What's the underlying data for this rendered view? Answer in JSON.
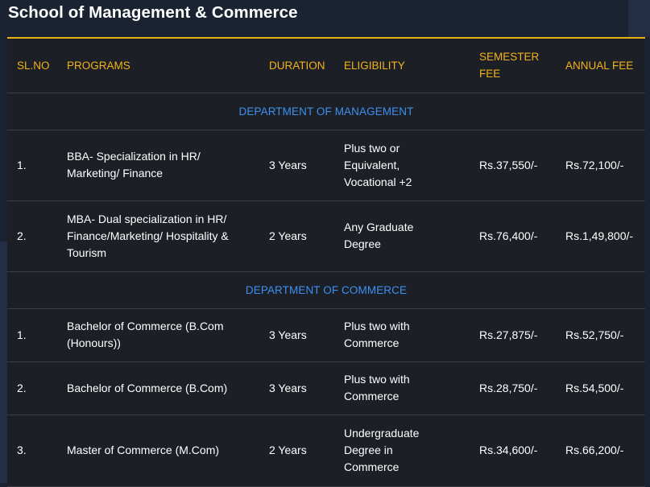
{
  "title": "School of Management & Commerce",
  "table": {
    "headers": {
      "sl_no": "SL.NO",
      "programs": "PROGRAMS",
      "duration": "DURATION",
      "eligibility": "ELIGIBILITY",
      "semester_fee": "SEMESTER FEE",
      "annual_fee": "ANNUAL FEE"
    },
    "departments": [
      {
        "name": "DEPARTMENT OF MANAGEMENT",
        "rows": [
          {
            "sl": "1.",
            "program": "BBA- Specialization in HR/ Marketing/ Finance",
            "duration": "3 Years",
            "eligibility": "Plus two or Equivalent, Vocational +2",
            "semester_fee": "Rs.37,550/-",
            "annual_fee": "Rs.72,100/-"
          },
          {
            "sl": "2.",
            "program": "MBA- Dual specialization in HR/ Finance/Marketing/ Hospitality & Tourism",
            "duration": "2 Years",
            "eligibility": "Any Graduate Degree",
            "semester_fee": "Rs.76,400/-",
            "annual_fee": "Rs.1,49,800/-"
          }
        ]
      },
      {
        "name": "DEPARTMENT OF COMMERCE",
        "rows": [
          {
            "sl": "1.",
            "program": "Bachelor of Commerce (B.Com (Honours))",
            "duration": "3 Years",
            "eligibility": "Plus two with Commerce",
            "semester_fee": "Rs.27,875/-",
            "annual_fee": "Rs.52,750/-"
          },
          {
            "sl": "2.",
            "program": "Bachelor of Commerce (B.Com)",
            "duration": "3 Years",
            "eligibility": "Plus two with Commerce",
            "semester_fee": "Rs.28,750/-",
            "annual_fee": "Rs.54,500/-"
          },
          {
            "sl": "3.",
            "program": "Master of Commerce (M.Com)",
            "duration": "2 Years",
            "eligibility": "Undergraduate Degree in Commerce",
            "semester_fee": "Rs.34,600/-",
            "annual_fee": "Rs.66,200/-"
          }
        ]
      }
    ]
  }
}
